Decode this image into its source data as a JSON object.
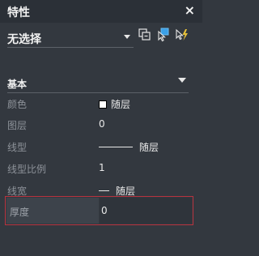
{
  "panel": {
    "title": "特性",
    "close_label": "×"
  },
  "selector": {
    "value": "无选择"
  },
  "toolbar": {
    "icons": [
      "toggle-pickadd-icon",
      "select-objects-icon",
      "quick-select-icon"
    ],
    "accent_color": "#3aa0e8",
    "quick_select_color": "#e8c23a"
  },
  "section": {
    "title": "基本"
  },
  "properties": [
    {
      "label": "颜色",
      "value": "随层",
      "swatch_color": "#ffffff"
    },
    {
      "label": "图层",
      "value": "0"
    },
    {
      "label": "线型",
      "value": "随层"
    },
    {
      "label": "线型比例",
      "value": "1"
    },
    {
      "label": "线宽",
      "value": "随层"
    },
    {
      "label": "厚度",
      "value": "0"
    }
  ]
}
